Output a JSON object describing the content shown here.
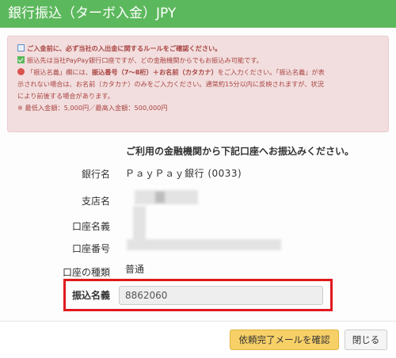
{
  "header": {
    "title": "銀行振込（ターボ入金）JPY"
  },
  "alert": {
    "line1_bold": "ご入金前に、必ず当社の入出金に関するルールをご確認ください。",
    "line2": "振込先は当社PayPay銀行口座ですが、どの金融機関からでもお振込み可能です。",
    "line3_pre": "「振込名義」欄には、",
    "line3_bold": "振込番号（7～8桁）＋お名前（カタカナ）",
    "line3_post": "をご入力ください。「振込名義」が表",
    "line4": "示されない場合は、お名前（カタカナ）のみをご入力ください。通常約15分以内に反映されますが、状況",
    "line5": "により前後する場合があります。",
    "line6": "※ 最低入金額：5,000円／最高入金額：500,000円"
  },
  "form": {
    "title": "ご利用の金融機関から下記口座へお振込みください。",
    "bank_label": "銀行名",
    "bank_value": "ＰａｙＰａｙ銀行 (0033)",
    "branch_label": "支店名",
    "account_name_label": "口座名義",
    "account_number_label": "口座番号",
    "account_type_label": "口座の種類",
    "account_type_value": "普通",
    "transfer_name_label": "振込名義",
    "transfer_name_value": "8862060"
  },
  "footer": {
    "confirm_label": "依頼完了メールを確認",
    "close_label": "閉じる"
  },
  "colors": {
    "header": "#5cb85c",
    "alert_bg": "#f2dede",
    "alert_text": "#a94442",
    "highlight_border": "#e0191f",
    "confirm_button": "#f7d068"
  }
}
